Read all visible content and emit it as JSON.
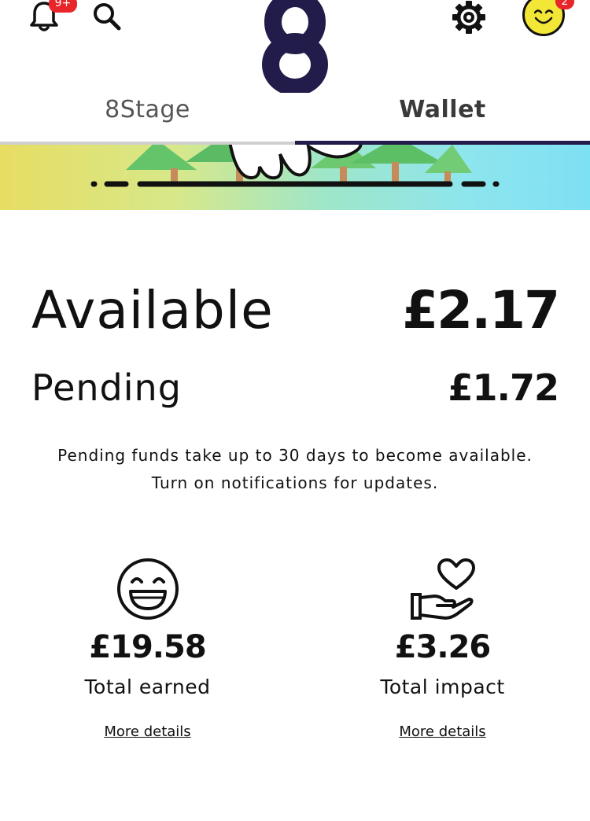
{
  "header": {
    "notifications_badge": "9+",
    "profile_badge": "2",
    "icons": [
      "bell-icon",
      "search-icon",
      "logo-8",
      "gear-icon",
      "smiley-avatar"
    ],
    "colors": {
      "brand_navy": "#221c4a",
      "badge_red": "#e8262a",
      "avatar_yellow": "#f2e636"
    }
  },
  "tabs": [
    {
      "label": "8Stage",
      "active": false
    },
    {
      "label": "Wallet",
      "active": true
    }
  ],
  "balances": {
    "available_label": "Available",
    "available_value": "£2.17",
    "pending_label": "Pending",
    "pending_value": "£1.72"
  },
  "note": {
    "line1": "Pending funds take up to 30 days to become available.",
    "line2": "Turn on notifications for updates."
  },
  "stats": [
    {
      "icon": "laughing-face-icon",
      "value": "£19.58",
      "label": "Total earned",
      "link": "More details"
    },
    {
      "icon": "heart-in-hand-icon",
      "value": "£3.26",
      "label": "Total impact",
      "link": "More details"
    }
  ]
}
